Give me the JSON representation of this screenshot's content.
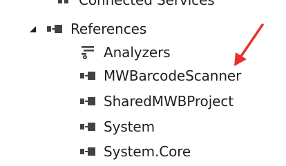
{
  "tree": {
    "partial_item": {
      "label": "Connected Services"
    },
    "references": {
      "label": "References",
      "expanded": true,
      "children": [
        {
          "label": "Analyzers",
          "icon": "analyzers-icon"
        },
        {
          "label": "MWBarcodeScanner",
          "icon": "reference-icon"
        },
        {
          "label": "SharedMWBProject",
          "icon": "reference-icon"
        },
        {
          "label": "System",
          "icon": "reference-icon"
        },
        {
          "label": "System.Core",
          "icon": "reference-icon"
        }
      ]
    }
  },
  "colors": {
    "text": "#1e1e1e",
    "icon": "#424242",
    "annotation_arrow": "#e8302a"
  }
}
